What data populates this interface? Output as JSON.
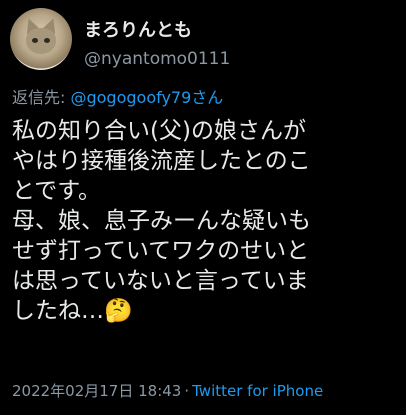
{
  "author": {
    "display_name": "まろりんとも",
    "username": "@nyantomo0111",
    "avatar_icon": "cat-avatar-icon"
  },
  "reply": {
    "prefix": "返信先: ",
    "mention": "@gogogoofy79さん"
  },
  "tweet": {
    "lines": [
      "私の知り合い(父)の娘さんが",
      "やはり接種後流産したとのこ",
      "とです。",
      "母、娘、息子みーんな疑いも",
      "せず打っていてワクのせいと",
      "は思っていないと言っていま",
      "したね…🤔"
    ]
  },
  "meta": {
    "timestamp": "2022年02月17日 18:43",
    "separator": "·",
    "source": "Twitter for iPhone"
  },
  "colors": {
    "background": "#000000",
    "text": "#e7e9ea",
    "muted": "#8b98a5",
    "accent": "#1d9bf0"
  }
}
